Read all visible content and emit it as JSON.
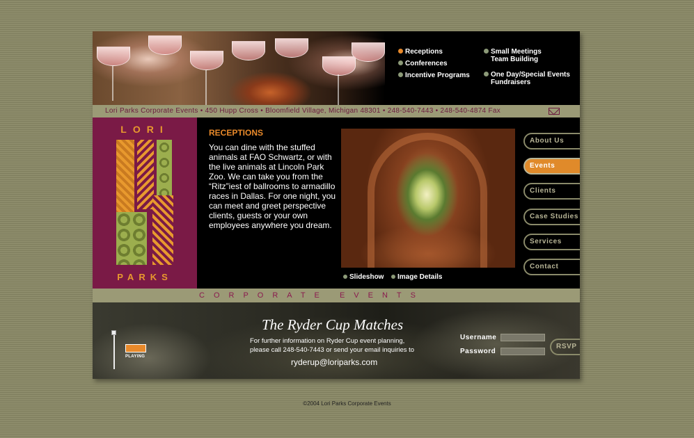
{
  "top_nav": {
    "left": [
      "Receptions",
      "Conferences",
      "Incentive Programs"
    ],
    "right": [
      [
        "Small Meetings",
        "Team Building"
      ],
      [
        "One Day/Special Events",
        "Fundraisers"
      ]
    ]
  },
  "address": "Lori Parks Corporate Events • 450 Hupp Cross • Bloomfield Village, Michigan 48301 • 248-540-7443 • 248-540-4874 Fax",
  "logo": {
    "line1": "LORI",
    "line2": "PARKS"
  },
  "section": {
    "title": "RECEPTIONS",
    "body": "You can dine with the stuffed animals at FAO Schwartz, or with the live animals at Lincoln Park Zoo. We can take you from the “Ritz”iest of ballrooms to armadillo races in Dallas. For one night, you can meet and greet perspective clients, guests or your own employees anywhere you dream."
  },
  "photo_links": {
    "slideshow": "Slideshow",
    "details": "Image Details"
  },
  "side_nav": [
    "About Us",
    "Events",
    "Clients",
    "Case Studies",
    "Services",
    "Contact"
  ],
  "strip": "CORPORATE EVENTS",
  "bottom": {
    "title": "The Ryder Cup Matches",
    "line1": "For further information on Ryder Cup event planning,",
    "line2": "please call 248-540-7443 or send your email inquiries to",
    "email": "ryderup@loriparks.com",
    "username_label": "Username",
    "password_label": "Password",
    "rsvp": "RSVP",
    "music_label": "PLAYING"
  },
  "copyright": "©2004 Lori Parks Corporate Events",
  "colors": {
    "accent": "#e8892a",
    "maroon": "#7a1a46",
    "olive": "#9b9a76"
  }
}
